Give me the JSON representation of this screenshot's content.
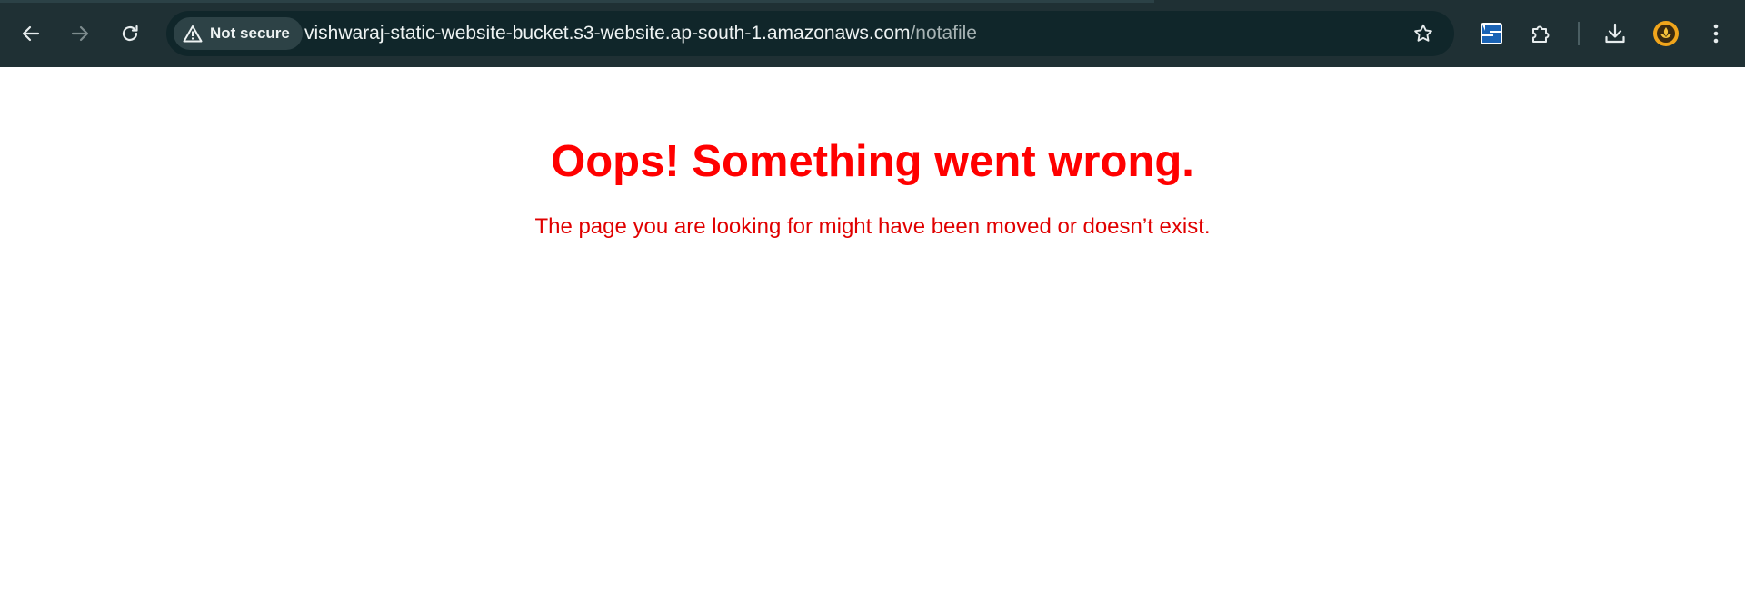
{
  "browser": {
    "colors": {
      "toolbar_bg": "#1f3034",
      "omnibox_bg": "#10262a",
      "chip_bg": "#2d4246"
    },
    "nav": {
      "back_icon": "arrow-left-icon",
      "forward_icon": "arrow-right-icon",
      "reload_icon": "reload-icon"
    },
    "omnibox": {
      "security_label": "Not secure",
      "security_icon": "warning-triangle-icon",
      "url_host": "vishwaraj-static-website-bucket.s3-website.ap-south-1.amazonaws.com",
      "url_path": "/notafile",
      "bookmark_icon": "star-icon"
    },
    "toolbar_icons": [
      "s-extension-icon",
      "puzzle-extensions-icon",
      "download-icon",
      "profile-avatar-icon",
      "kebab-menu-icon"
    ]
  },
  "page": {
    "title": "Oops! Something went wrong.",
    "message": "The page you are looking for might have been moved or doesn’t exist.",
    "text_color": "#ff0000"
  }
}
